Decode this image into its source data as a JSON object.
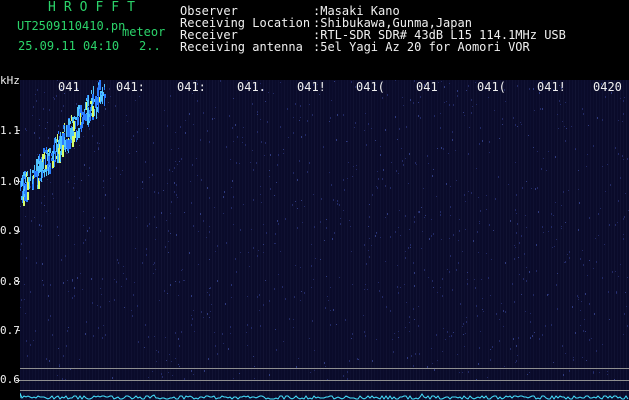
{
  "header": {
    "brand": "HROFFT",
    "filename": "UT2509110410.pn",
    "overlay": "meteor",
    "datetime": "25.09.11 04:10",
    "counter": "2..",
    "labels": [
      "Observer",
      "Receiving Location",
      "Receiver",
      "Receiving antenna"
    ],
    "values": [
      ":Masaki Kano",
      ":Shibukawa,Gunma,Japan",
      ":RTL-SDR SDR# 43dB L15 114.1MHz USB",
      ":5el Yagi Az 20 for Aomori VOR"
    ]
  },
  "axes": {
    "y_unit": "kHz",
    "y_ticks": [
      "1.1",
      "1.0",
      "0.9",
      "0.8",
      "0.7",
      "0.6"
    ],
    "x_ticks": [
      "041",
      "041:",
      "041:",
      "041.",
      "041!",
      "041(",
      "041",
      "041(",
      "041!",
      "0420"
    ]
  },
  "colors": {
    "background": "#0a0b2a",
    "brand": "#2bd36a",
    "signal": "#4fc3ff",
    "strong": "#d6ff6a",
    "baseline": "#46e0ff"
  }
}
